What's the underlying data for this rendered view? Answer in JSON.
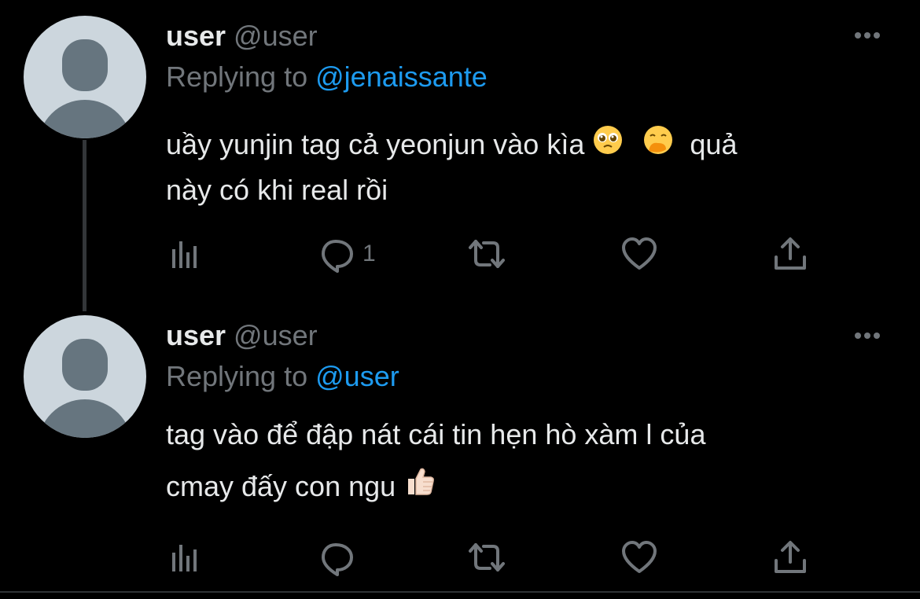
{
  "tweets": [
    {
      "name": "user",
      "handle": "@user",
      "replying_prefix": "Replying to",
      "replying_to": "@jenaissante",
      "text_line1": "uầy yunjin tag cả yeonjun vào kìa",
      "text_line1_end": "quả",
      "text_line2": "này có khi real rồi",
      "emojis": [
        "pleading-face-emoji",
        "face-with-hand-over-mouth-emoji"
      ],
      "reply_count": "1"
    },
    {
      "name": "user",
      "handle": "@user",
      "replying_prefix": "Replying to",
      "replying_to": "@user",
      "text_line1": "tag vào để đập nát cái tin hẹn hò xàm l của",
      "text_line2": "cmay đấy con ngu",
      "emojis": [
        "thumbs-up-light-skin-emoji"
      ],
      "reply_count": ""
    }
  ],
  "icons": [
    "analytics-icon",
    "reply-icon",
    "retweet-icon",
    "like-icon",
    "share-icon",
    "more-icon"
  ],
  "colors": {
    "background": "#000000",
    "text": "#e7e9ea",
    "muted": "#71767b",
    "accent": "#1d9bf0",
    "avatar_bg": "#ccd6dd",
    "avatar_fg": "#66757f"
  }
}
